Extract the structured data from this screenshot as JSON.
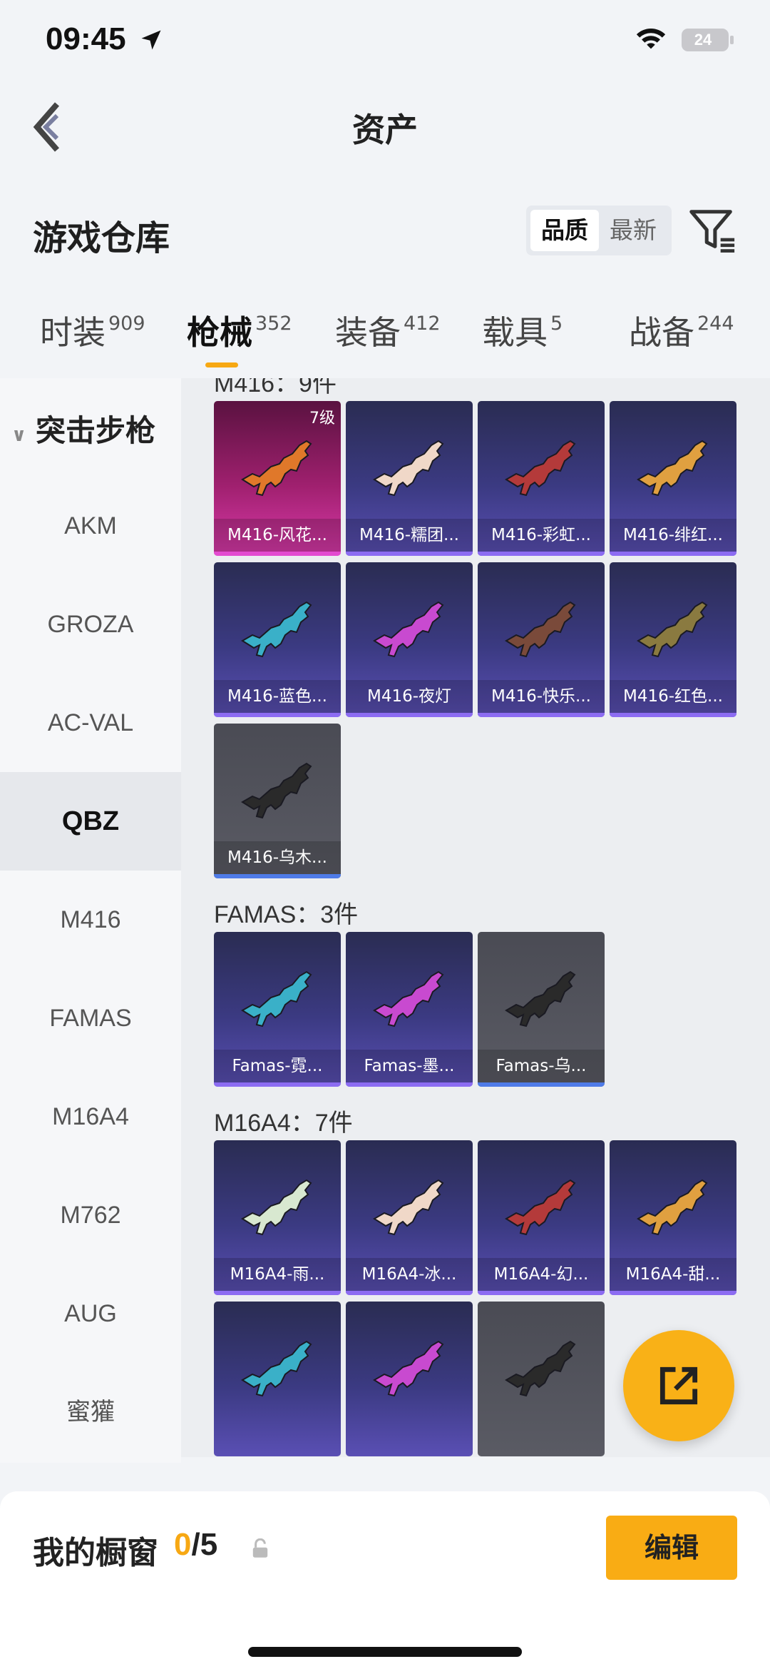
{
  "status": {
    "time": "09:45",
    "battery": "24"
  },
  "nav": {
    "title": "资产"
  },
  "warehouse": {
    "title": "游戏仓库",
    "sort": [
      "品质",
      "最新"
    ],
    "sort_active": 0
  },
  "tabs": [
    {
      "label": "时装",
      "count": "909"
    },
    {
      "label": "枪械",
      "count": "352",
      "active": true
    },
    {
      "label": "装备",
      "count": "412"
    },
    {
      "label": "载具",
      "count": "5"
    },
    {
      "label": "战备",
      "count": "244"
    }
  ],
  "sidebar": {
    "group": "突击步枪",
    "items": [
      "AKM",
      "GROZA",
      "AC-VAL",
      "QBZ",
      "M416",
      "FAMAS",
      "M16A4",
      "M762",
      "AUG",
      "蜜獾"
    ],
    "active": "QBZ"
  },
  "sections": [
    {
      "title": "M416：9件",
      "cards": [
        {
          "name": "M416-风花...",
          "level": "7级",
          "rarity": "pink"
        },
        {
          "name": "M416-糯团...",
          "rarity": "purple"
        },
        {
          "name": "M416-彩虹...",
          "rarity": "purple"
        },
        {
          "name": "M416-绯红...",
          "rarity": "purple"
        },
        {
          "name": "M416-蓝色...",
          "rarity": "purple"
        },
        {
          "name": "M416-夜灯",
          "rarity": "purple"
        },
        {
          "name": "M416-快乐...",
          "rarity": "purple"
        },
        {
          "name": "M416-红色...",
          "rarity": "purple"
        },
        {
          "name": "M416-乌木...",
          "rarity": "grey"
        }
      ]
    },
    {
      "title": "FAMAS：3件",
      "cards": [
        {
          "name": "Famas-霓...",
          "rarity": "purple"
        },
        {
          "name": "Famas-墨...",
          "rarity": "purple"
        },
        {
          "name": "Famas-乌...",
          "rarity": "grey"
        }
      ]
    },
    {
      "title": "M16A4：7件",
      "cards": [
        {
          "name": "M16A4-雨...",
          "rarity": "purple"
        },
        {
          "name": "M16A4-冰...",
          "rarity": "purple"
        },
        {
          "name": "M16A4-幻...",
          "rarity": "purple"
        },
        {
          "name": "M16A4-甜...",
          "rarity": "purple"
        },
        {
          "name": "",
          "rarity": "purple"
        },
        {
          "name": "",
          "rarity": "purple"
        },
        {
          "name": "",
          "rarity": "grey"
        }
      ]
    }
  ],
  "bottom": {
    "label": "我的橱窗",
    "current": "0",
    "total": "/5",
    "edit": "编辑"
  },
  "colors": {
    "accent": "#f7a813",
    "purple_card": "#3b3a82",
    "pink_card": "#d93aaa",
    "grey_card": "#5a5b64"
  }
}
